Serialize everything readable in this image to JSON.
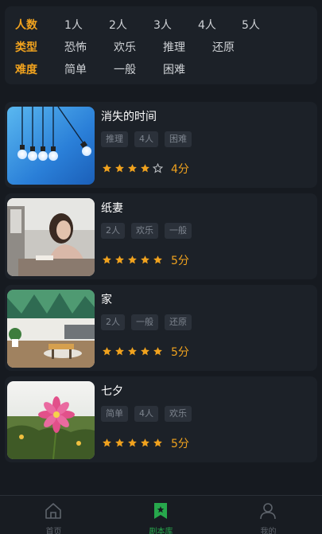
{
  "filters": {
    "players": {
      "label": "人数",
      "options": [
        "1人",
        "2人",
        "3人",
        "4人",
        "5人"
      ]
    },
    "type": {
      "label": "类型",
      "options": [
        "恐怖",
        "欢乐",
        "推理",
        "还原"
      ]
    },
    "difficulty": {
      "label": "难度",
      "options": [
        "简单",
        "一般",
        "困难"
      ]
    }
  },
  "scripts": [
    {
      "title": "消失的时间",
      "tags": [
        "推理",
        "4人",
        "困难"
      ],
      "rating": 4,
      "score": "4分",
      "image": "light-bulbs"
    },
    {
      "title": "纸妻",
      "tags": [
        "2人",
        "欢乐",
        "一般"
      ],
      "rating": 5,
      "score": "5分",
      "image": "woman-reading"
    },
    {
      "title": "家",
      "tags": [
        "2人",
        "一般",
        "还原"
      ],
      "rating": 5,
      "score": "5分",
      "image": "living-room"
    },
    {
      "title": "七夕",
      "tags": [
        "简单",
        "4人",
        "欢乐"
      ],
      "rating": 5,
      "score": "5分",
      "image": "pink-flower"
    }
  ],
  "tabbar": {
    "home": {
      "label": "首页",
      "icon": "home-icon"
    },
    "library": {
      "label": "剧本库",
      "icon": "bookmark-icon"
    },
    "mine": {
      "label": "我的",
      "icon": "user-icon"
    }
  },
  "colors": {
    "accent": "#f0a21e",
    "active_tab": "#27a84c",
    "background": "#161a20",
    "card": "#1c2128"
  }
}
